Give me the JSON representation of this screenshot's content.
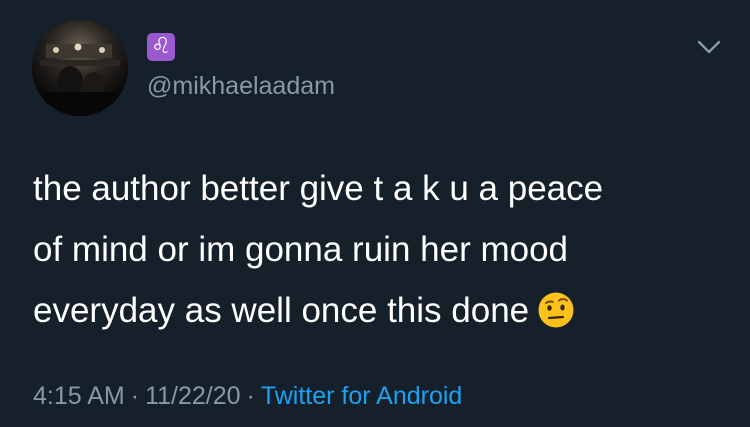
{
  "tweet": {
    "display_name_icon": "leo-zodiac-icon",
    "display_name_glyph": "♌",
    "handle": "@mikhaelaadam",
    "text_lines": [
      "the author better give t a k u a peace",
      "of mind or im gonna ruin her mood",
      "everyday as well once this done"
    ],
    "emoji": "face-with-raised-eyebrow-icon",
    "time": "4:15 AM",
    "separator": "·",
    "date": "11/22/20",
    "source": "Twitter for Android"
  },
  "menu": {
    "icon": "chevron-down-icon"
  },
  "colors": {
    "background": "#15202b",
    "text": "#ffffff",
    "secondary": "#8899a6",
    "link": "#1da1f2",
    "badge": "#9b59d0"
  }
}
